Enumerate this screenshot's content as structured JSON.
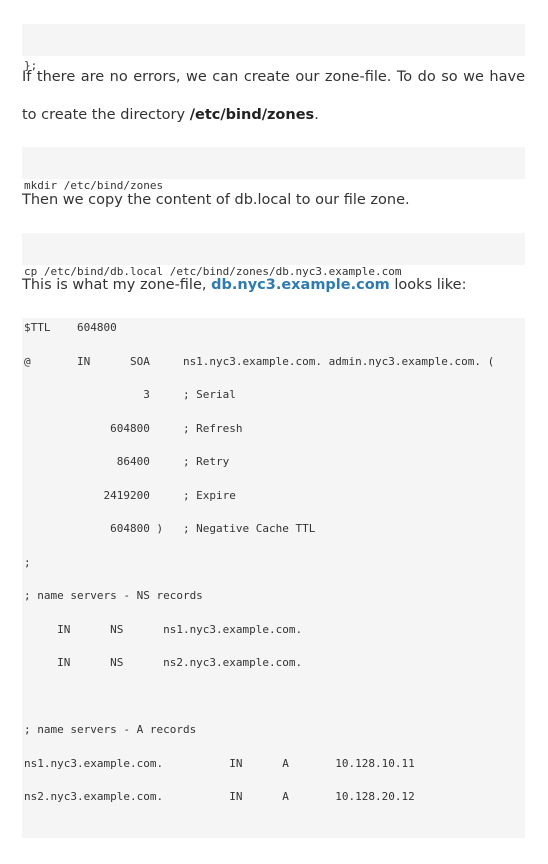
{
  "blocks": {
    "code1": {
      "text": "};"
    },
    "para1": {
      "text_before": "If there are no errors, we can create our zone-file. To do so we have to create the directory ",
      "bold": "/etc/bind/zones",
      "text_after": "."
    },
    "code2": {
      "text": "mkdir /etc/bind/zones"
    },
    "para2": {
      "text": "Then we copy the content of db.local to our file zone."
    },
    "code3": {
      "text": "cp /etc/bind/db.local /etc/bind/zones/db.nyc3.example.com"
    },
    "para3": {
      "text_before": "This is what my zone-file, ",
      "link": "db.nyc3.example.com",
      "text_after": " looks like:"
    },
    "zonefile": {
      "lines": [
        "$TTL    604800",
        "@       IN      SOA     ns1.nyc3.example.com. admin.nyc3.example.com. (",
        "                  3     ; Serial",
        "             604800     ; Refresh",
        "              86400     ; Retry",
        "            2419200     ; Expire",
        "             604800 )   ; Negative Cache TTL",
        ";",
        "; name servers - NS records",
        "     IN      NS      ns1.nyc3.example.com.",
        "     IN      NS      ns2.nyc3.example.com.",
        "",
        "; name servers - A records",
        "ns1.nyc3.example.com.          IN      A       10.128.10.11",
        "ns2.nyc3.example.com.          IN      A       10.128.20.12"
      ]
    }
  },
  "colors": {
    "code_background": "#f5f5f5",
    "link": "#2f7bb0",
    "text": "#333333"
  }
}
